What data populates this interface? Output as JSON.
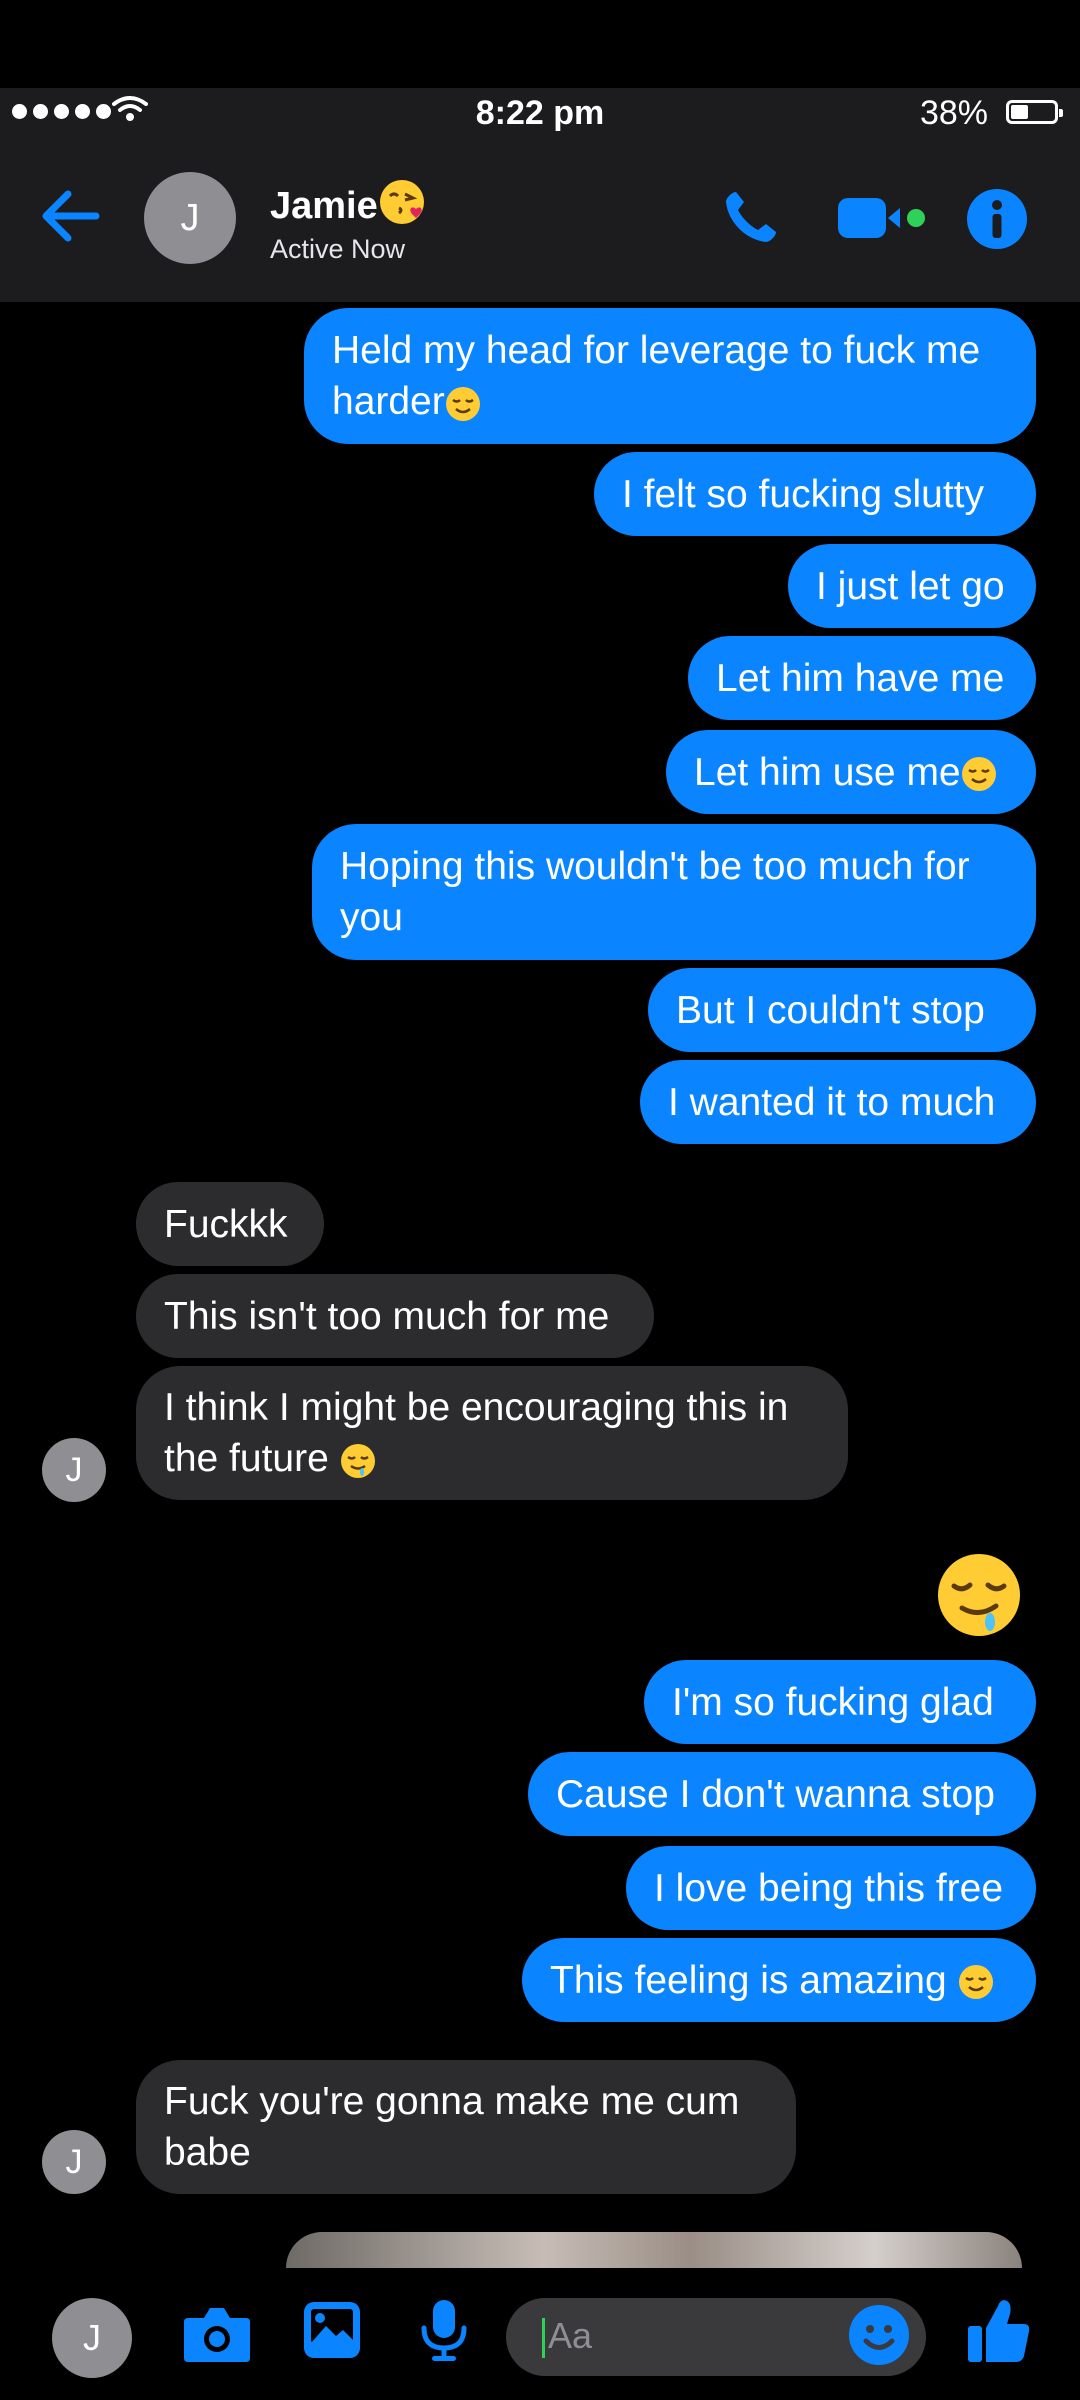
{
  "status_bar": {
    "time": "8:22 pm",
    "battery": "38%"
  },
  "header": {
    "avatar_initial": "J",
    "contact_name": "Jamie",
    "contact_status": "Active Now"
  },
  "messages": [
    {
      "from": "me",
      "text": "Held my head for leverage to fuck me\nharder"
    },
    {
      "from": "me",
      "text": "I felt so fucking slutty"
    },
    {
      "from": "me",
      "text": "I just let go"
    },
    {
      "from": "me",
      "text": "Let him have me"
    },
    {
      "from": "me",
      "text": "Let him use me"
    },
    {
      "from": "me",
      "text": "Hoping this wouldn't be too much for\nyou"
    },
    {
      "from": "me",
      "text": "But I couldn't stop"
    },
    {
      "from": "me",
      "text": "I wanted it to much"
    },
    {
      "from": "them",
      "text": "Fuckkk"
    },
    {
      "from": "them",
      "text": "This isn't too much for me"
    },
    {
      "from": "them",
      "text": "I think I might be encouraging this in\nthe future "
    },
    {
      "from": "me",
      "text": "I'm so fucking glad"
    },
    {
      "from": "me",
      "text": "Cause I don't wanna stop"
    },
    {
      "from": "me",
      "text": "I love being this free"
    },
    {
      "from": "me",
      "text": "This feeling is amazing "
    },
    {
      "from": "them",
      "text": "Fuck you're gonna make me cum\nbabe"
    }
  ],
  "contact_avatar_initial": "J",
  "composer": {
    "avatar_initial": "J",
    "placeholder": "Aa"
  },
  "colors": {
    "accent": "#0a84ff",
    "incoming_bubble": "#2c2c2e",
    "header": "#1c1c1e",
    "active_dot": "#30d158"
  }
}
